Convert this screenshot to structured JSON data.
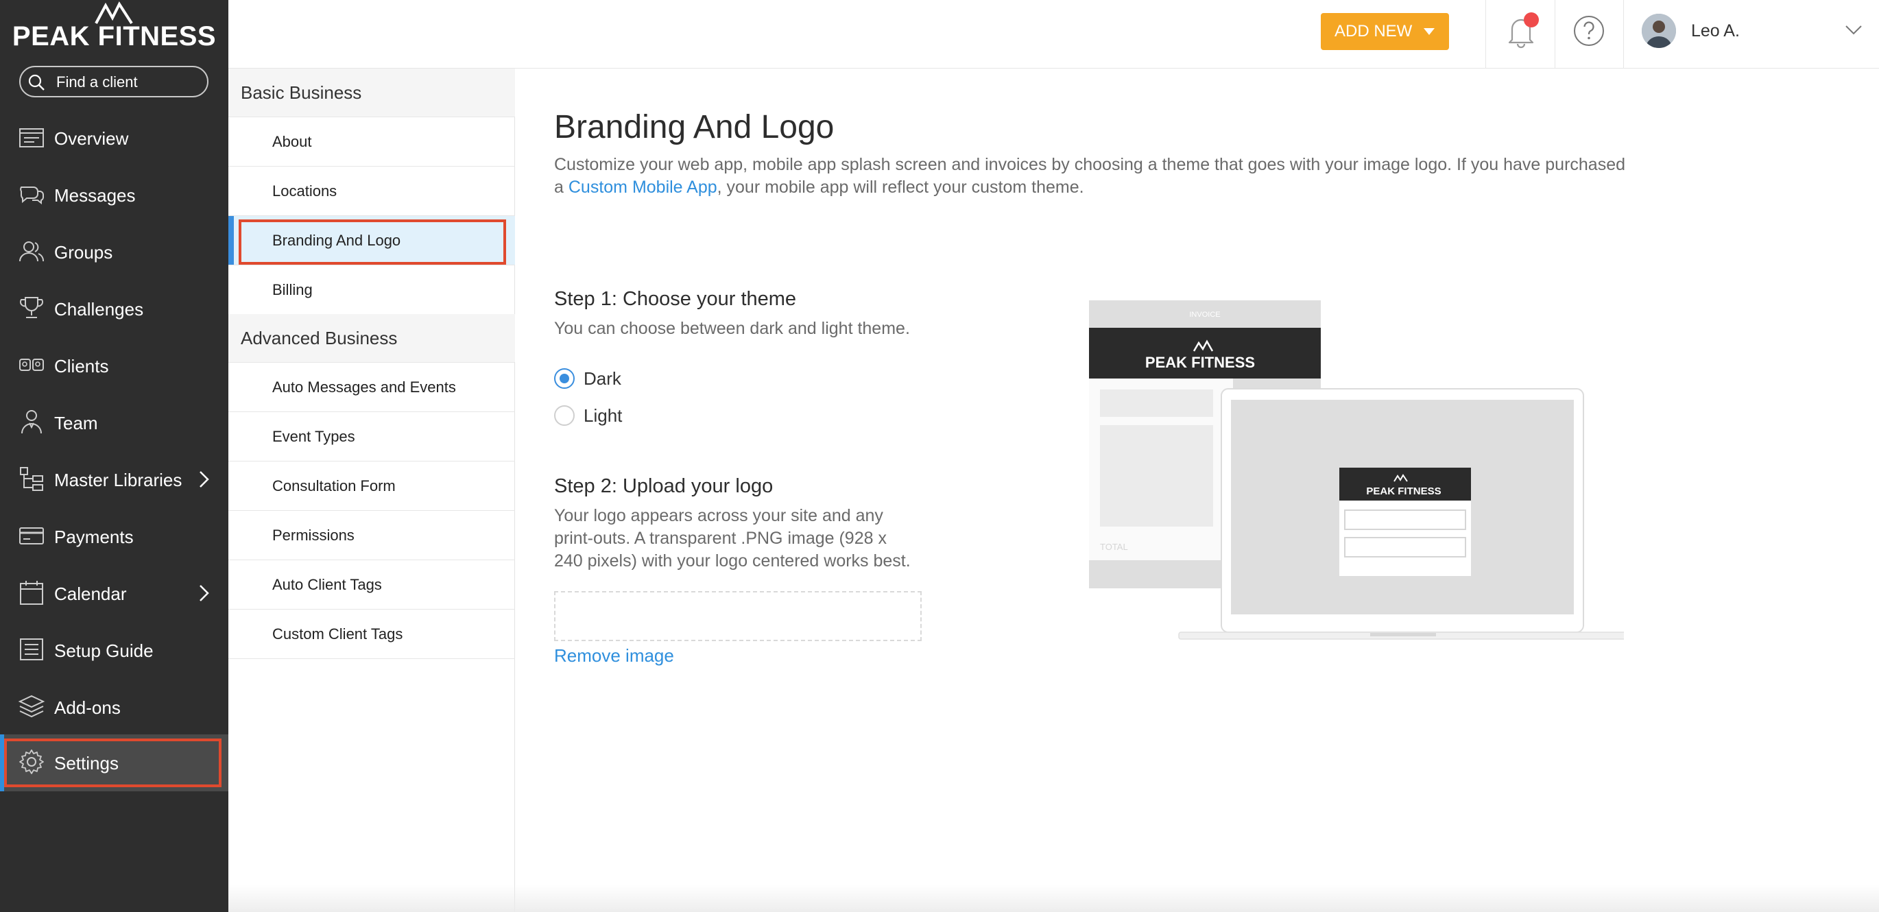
{
  "brand": {
    "name": "PEAK FITNESS"
  },
  "search": {
    "placeholder": "Find a client"
  },
  "nav": {
    "items": [
      {
        "label": "Overview"
      },
      {
        "label": "Messages"
      },
      {
        "label": "Groups"
      },
      {
        "label": "Challenges"
      },
      {
        "label": "Clients"
      },
      {
        "label": "Team"
      },
      {
        "label": "Master Libraries"
      },
      {
        "label": "Payments"
      },
      {
        "label": "Calendar"
      },
      {
        "label": "Setup Guide"
      },
      {
        "label": "Add-ons"
      },
      {
        "label": "Settings"
      }
    ],
    "active": "Settings"
  },
  "topbar": {
    "add_new_label": "ADD NEW",
    "user_name": "Leo A."
  },
  "subnav": {
    "basic_header": "Basic Business",
    "basic_items": [
      "About",
      "Locations",
      "Branding And Logo",
      "Billing"
    ],
    "advanced_header": "Advanced Business",
    "advanced_items": [
      "Auto Messages and Events",
      "Event Types",
      "Consultation Form",
      "Permissions",
      "Auto Client Tags",
      "Custom Client Tags"
    ],
    "active": "Branding And Logo"
  },
  "main": {
    "title": "Branding And Logo",
    "desc_before": "Customize your web app, mobile app splash screen and invoices by choosing a theme that goes with your image logo. If you have purchased a ",
    "desc_link": "Custom Mobile App",
    "desc_after": ", your mobile app will reflect your custom theme.",
    "step1_title": "Step 1: Choose your theme",
    "step1_desc": "You can choose between dark and light theme.",
    "theme_options": [
      "Dark",
      "Light"
    ],
    "selected_theme": "Dark",
    "step2_title": "Step 2: Upload your logo",
    "step2_desc_line1": "Your logo appears across your site and any",
    "step2_desc_line2": "print-outs. A transparent .PNG image (928 x",
    "step2_desc_line3": "240 pixels) with your logo centered works best.",
    "remove_image_label": "Remove image"
  },
  "preview": {
    "invoice_label": "INVOICE",
    "brand": "PEAK FITNESS",
    "total_label": "TOTAL"
  },
  "colors": {
    "sidebar_bg": "#2e2e2e",
    "accent_orange": "#f5a623",
    "link_blue": "#2f8fdd",
    "highlight_red": "#e04a2e",
    "notification_red": "#ef4b4b"
  }
}
